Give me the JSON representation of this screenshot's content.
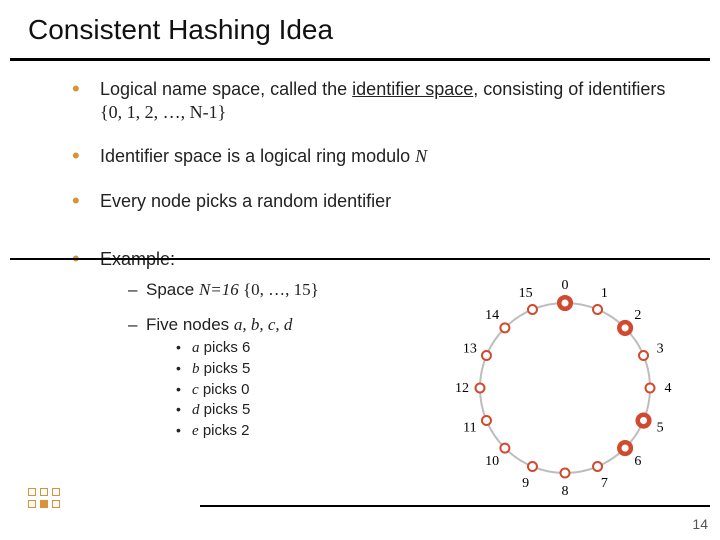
{
  "title": "Consistent Hashing Idea",
  "bullets": {
    "b1a": "Logical name space, called the ",
    "b1b": "identifier space",
    "b1c": ", consisting of identifiers ",
    "b1d": "{0, 1, 2, …, N-1}",
    "b2a": "Identifier space is a logical ring modulo ",
    "b2b": "N",
    "b3": "Every node picks a random identifier",
    "b4": "Example:"
  },
  "example": {
    "d1a": "Space ",
    "d1b": "N=16",
    "d1c": " {0, …, 15}",
    "d2a": "Five nodes ",
    "d2b": "a, b, c, d",
    "picks": {
      "p1a": "a",
      "p1b": " picks 6",
      "p2a": "b",
      "p2b": " picks 5",
      "p3a": "c",
      "p3b": " picks 0",
      "p4a": "d",
      "p4b": " picks 5",
      "p5a": "e",
      "p5b": " picks 2"
    }
  },
  "ring": {
    "n": 16,
    "labels": [
      "0",
      "1",
      "2",
      "3",
      "4",
      "5",
      "6",
      "7",
      "8",
      "9",
      "10",
      "11",
      "12",
      "13",
      "14",
      "15"
    ],
    "selected": [
      0,
      2,
      5,
      6
    ]
  },
  "page_number": "14"
}
